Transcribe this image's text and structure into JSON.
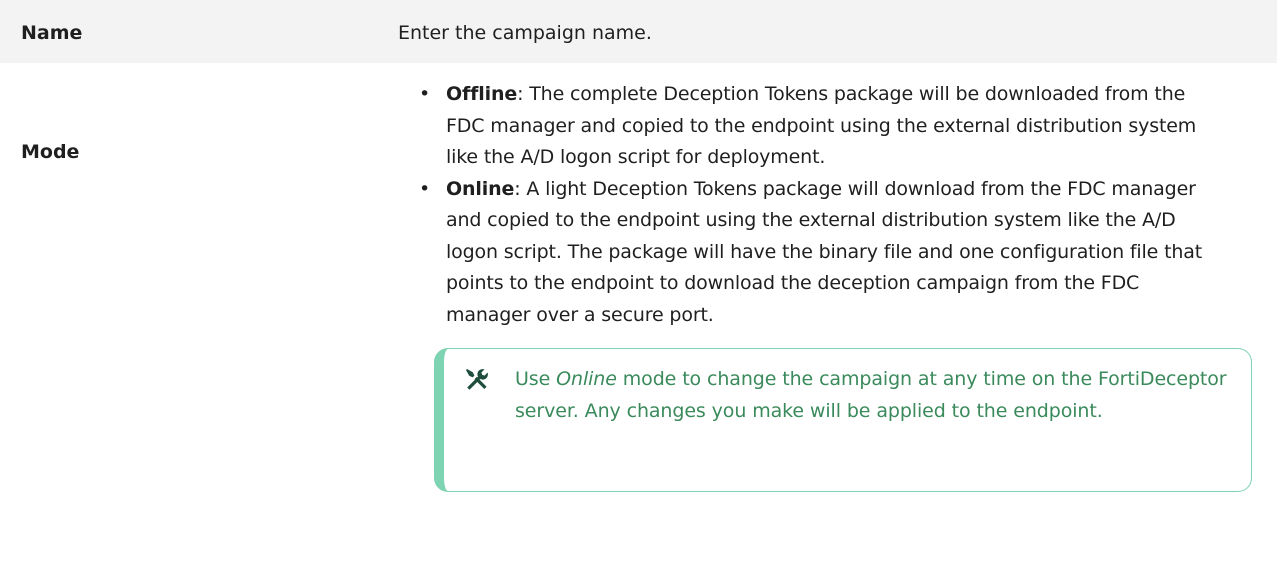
{
  "table": {
    "rows": [
      {
        "label": "Name",
        "value": "Enter the campaign name."
      },
      {
        "label": "Mode",
        "options": [
          {
            "term": "Offline",
            "description": ": The complete Deception Tokens package will be downloaded from the FDC manager and copied to the endpoint using the external distribution system like the A/D logon script for deployment."
          },
          {
            "term": "Online",
            "description": ": A light Deception Tokens package will download from the FDC manager and copied to the endpoint using the external distribution system like the A/D logon script. The package will have the binary file and one configuration file that points to the endpoint to download the deception campaign from the FDC manager over a secure port."
          }
        ],
        "note": {
          "icon": "tools-icon",
          "prefix": "Use ",
          "emphasis": "Online",
          "suffix": " mode to change the campaign at any time on the FortiDeceptor server. Any changes you make will be applied to the endpoint."
        }
      }
    ]
  },
  "colors": {
    "header_bg": "#f3f3f3",
    "note_border": "#7ed3b2",
    "note_text": "#3a8a5c",
    "icon": "#1f4e3d"
  }
}
